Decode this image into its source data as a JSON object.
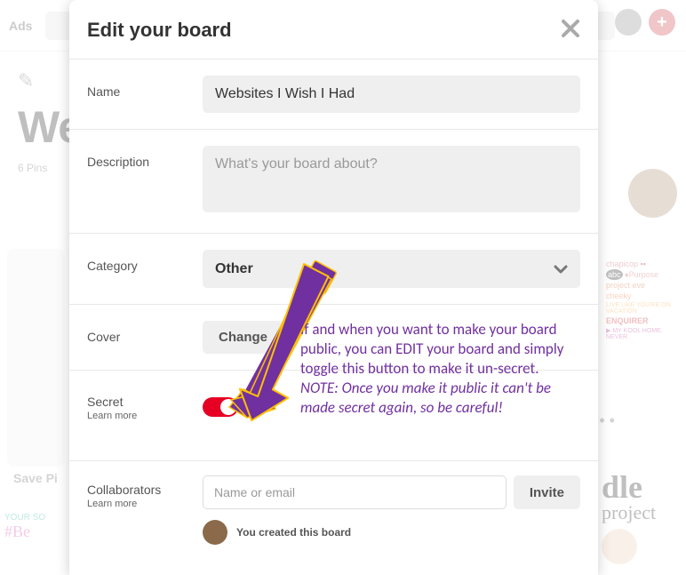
{
  "bg": {
    "nav_ads": "Ads",
    "page_title": "Web",
    "pins_count": "6 Pins",
    "save_pin": "Save Pi",
    "bl_line1": "YOUR SO",
    "bl_line2": "#Be",
    "br_line1": "dle",
    "br_line2": "project",
    "dots": "• • •"
  },
  "modal": {
    "title": "Edit your board",
    "labels": {
      "name": "Name",
      "description": "Description",
      "category": "Category",
      "cover": "Cover",
      "secret": "Secret",
      "learn_more": "Learn more",
      "collaborators": "Collaborators"
    },
    "values": {
      "name": "Websites I Wish I Had",
      "category": "Other",
      "change_btn": "Change",
      "invite_btn": "Invite",
      "created_text": "You created this board"
    },
    "placeholders": {
      "description": "What's your board about?",
      "collaborator": "Name or email"
    }
  },
  "annotation": {
    "text1": "If and when you want to make your board public, you can EDIT your board and simply toggle this button to make it un-secret.",
    "text2": "NOTE: Once you make it public it can't be made secret again, so be careful!"
  }
}
